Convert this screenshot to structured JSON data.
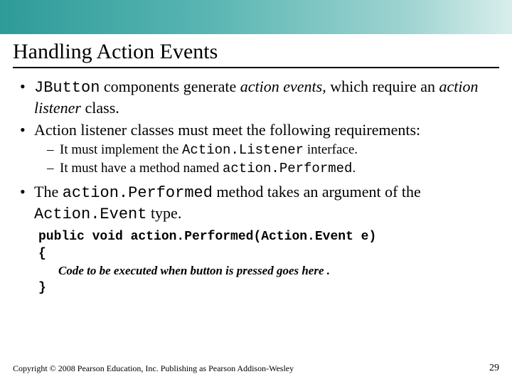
{
  "header": {
    "title": "Handling Action Events"
  },
  "bullets": {
    "b1_pre": "",
    "b1_code": "JButton",
    "b1_mid": " components generate ",
    "b1_ital": "action events",
    "b1_post": ", which require an ",
    "b1_ital2": "action listener",
    "b1_end": " class.",
    "b2": "Action listener classes must meet the following requirements:",
    "sub1_pre": "It must implement the ",
    "sub1_code": "Action.Listener",
    "sub1_post": " interface.",
    "sub2_pre": "It must have a method named ",
    "sub2_code": "action.Performed",
    "sub2_post": ".",
    "b3_pre": "The ",
    "b3_code1": "action.Performed",
    "b3_mid": " method takes an argument of the ",
    "b3_code2": "Action.Event",
    "b3_post": " type."
  },
  "code": {
    "line1": "public void action.Performed(Action.Event e)",
    "line2": "{",
    "comment": "Code to be executed when button is pressed goes here .",
    "line3": "}"
  },
  "footer": {
    "copyright": "Copyright © 2008 Pearson Education, Inc. Publishing as Pearson Addison-Wesley",
    "page": "29"
  }
}
